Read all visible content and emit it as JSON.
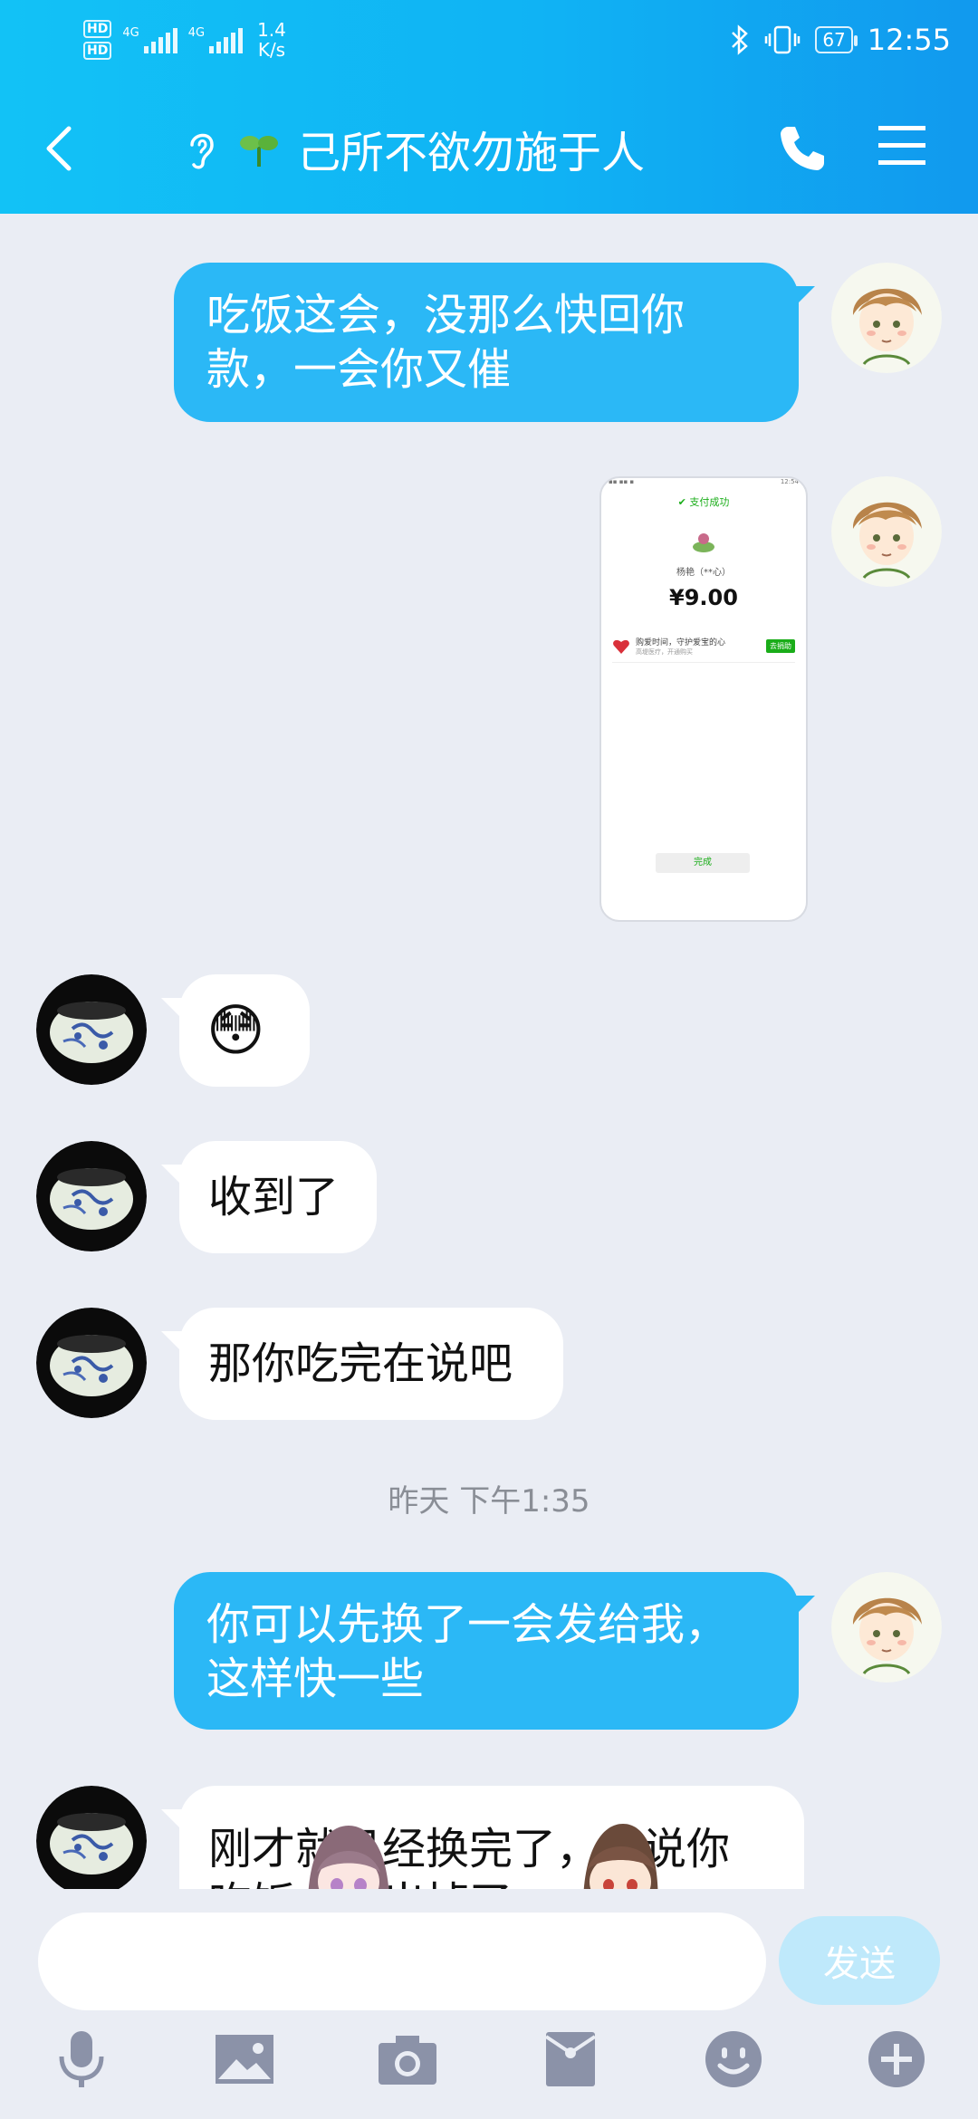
{
  "status_bar": {
    "hd_1": "HD",
    "hd_2": "HD",
    "sim1_network": "4G",
    "sim2_network": "4G",
    "speed_value": "1.4",
    "speed_unit": "K/s",
    "battery": "67",
    "time": "12:55"
  },
  "header": {
    "title": "己所不欲勿施于人",
    "icons": [
      "back-icon",
      "ear-icon",
      "sprout-icon",
      "phone-icon",
      "menu-icon"
    ]
  },
  "messages": [
    {
      "direction": "out",
      "type": "text",
      "text": "吃饭这会，没那么快回你款，一会你又催",
      "line1": "吃饭这会，没那么快回你",
      "line2": "款，一会你又催"
    },
    {
      "direction": "out",
      "type": "image",
      "screenshot": {
        "status_text": "12:54",
        "paid_label": "支付成功",
        "merchant": "杨艳（**心）",
        "amount": "¥9.00",
        "ad_title": "购爱时间，守护爱宝的心",
        "ad_sub": "高堤医疗，开通购买",
        "ad_button": "去捐助",
        "done_button": "完成"
      }
    },
    {
      "direction": "in",
      "type": "emoji",
      "text": "😳"
    },
    {
      "direction": "in",
      "type": "text",
      "text": "收到了"
    },
    {
      "direction": "in",
      "type": "text",
      "text": "那你吃完在说吧"
    },
    {
      "direction": "out",
      "type": "text",
      "text": "你可以先换了一会发给我，这样快一些",
      "line1": "你可以先换了一会发给我，",
      "line2": "这样快一些"
    },
    {
      "direction": "in",
      "type": "text",
      "text": "刚才就已经换完了，你说你吃饭，在出掉了",
      "line1": "刚才就已经换完了，你说你",
      "line2": "吃饭，在出掉了"
    }
  ],
  "timestamp": "昨天 下午1:35",
  "composer": {
    "input_value": "",
    "send_label": "发送"
  },
  "toolbar": [
    "mic-icon",
    "image-icon",
    "camera-icon",
    "red-packet-icon",
    "emoji-icon",
    "plus-icon"
  ],
  "colors": {
    "header_start": "#12c2f6",
    "header_end": "#1199ee",
    "outgoing_bubble": "#2bb8f6",
    "incoming_bubble": "#ffffff",
    "background": "#eaedf4",
    "send_disabled": "#bfe9fb",
    "toolbar_icon": "#8b92a8"
  }
}
